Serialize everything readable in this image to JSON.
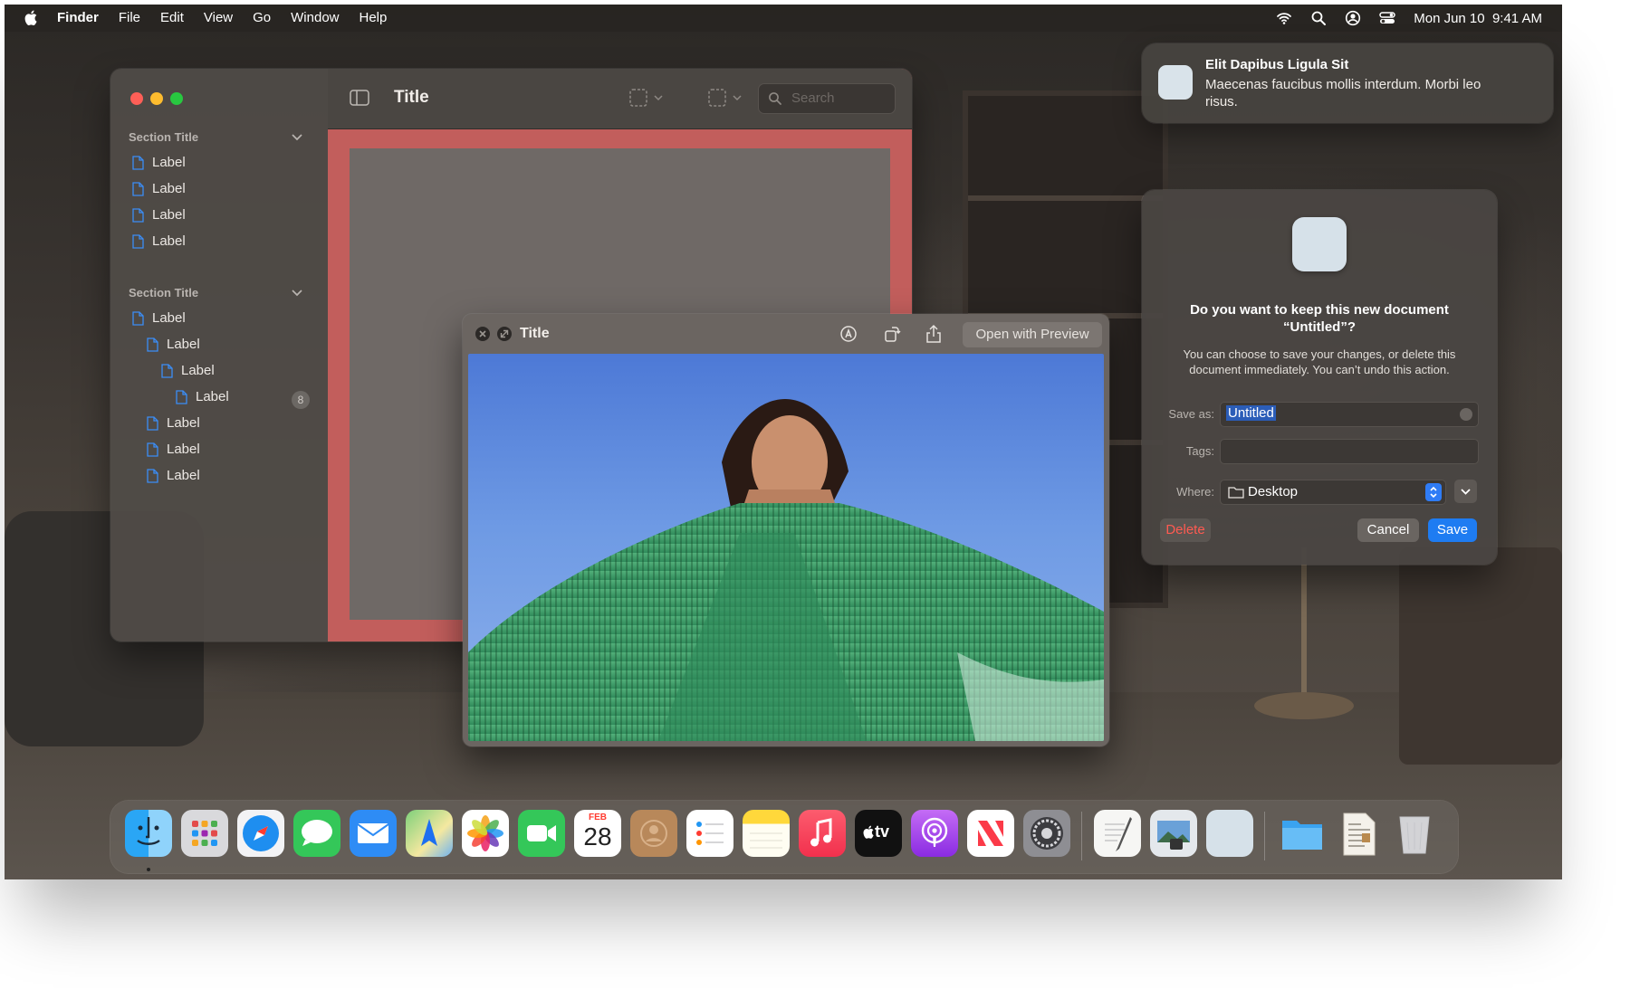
{
  "menubar": {
    "app": "Finder",
    "menus": [
      "File",
      "Edit",
      "View",
      "Go",
      "Window",
      "Help"
    ],
    "datetime": "Mon Jun 10  9:41 AM"
  },
  "finder": {
    "title": "Title",
    "search_placeholder": "Search",
    "sections": [
      {
        "title": "Section Title",
        "items": [
          "Label",
          "Label",
          "Label",
          "Label"
        ]
      },
      {
        "title": "Section Title",
        "items": [
          "Label",
          "Label",
          "Label",
          "Label",
          "Label",
          "Label",
          "Label"
        ],
        "badge": "8"
      }
    ]
  },
  "quicklook": {
    "title": "Title",
    "open_button": "Open with Preview"
  },
  "notification": {
    "title": "Elit Dapibus Ligula Sit",
    "body": "Maecenas faucibus mollis interdum. Morbi leo risus."
  },
  "dialog": {
    "question": "Do you want to keep this new document “Untitled”?",
    "subtext": "You can choose to save your changes, or delete this document immediately. You can’t undo this action.",
    "save_as_label": "Save as:",
    "save_as_value": "Untitled",
    "tags_label": "Tags:",
    "where_label": "Where:",
    "where_value": "Desktop",
    "delete_label": "Delete",
    "cancel_label": "Cancel",
    "save_label": "Save"
  },
  "dock": {
    "calendar_month": "FEB",
    "calendar_day": "28",
    "tv_label": "tv"
  },
  "colors": {
    "accent": "#1e7cf2",
    "destructive": "#ff5a51",
    "close": "#fe5f57",
    "minimize": "#febc2e",
    "zoom": "#28c840"
  }
}
